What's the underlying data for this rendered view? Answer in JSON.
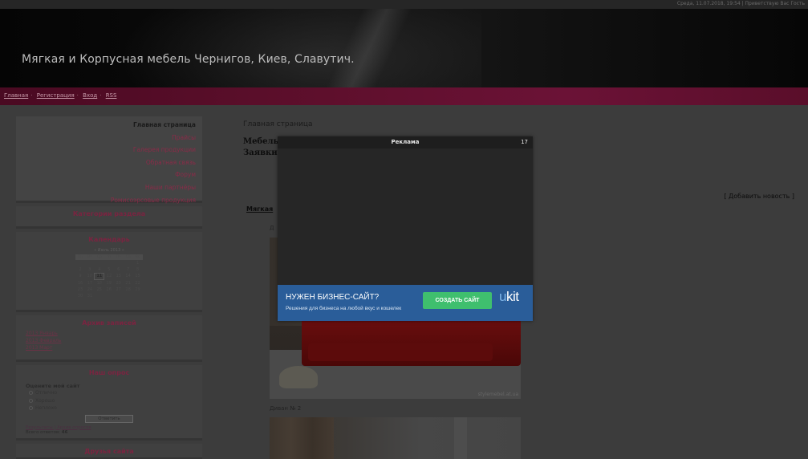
{
  "topbar": {
    "info": "Среда, 11.07.2018, 19:54 | Приветствую Вас Гость"
  },
  "header": {
    "title": "Мягкая и Корпусная мебель Чернигов, Киев, Славутич."
  },
  "nav": {
    "links": [
      "Главная",
      "Регистрация",
      "Вход",
      "RSS"
    ]
  },
  "sidebar": {
    "menu": [
      "Главная страница",
      "Прайсы",
      "Галерея продукции",
      "Обратная связь",
      "Форум",
      "Наши партнёры",
      "Ромисоэрсовые продукция"
    ],
    "categories_title": "Категории раздела",
    "calendar_title": "Календарь",
    "calendar": {
      "month": "« Июль 2013 »",
      "days": [
        "Пн",
        "Вт",
        "Ср",
        "Чт",
        "Пт",
        "Сб",
        "Вс"
      ],
      "weeks": [
        [
          "",
          "",
          "",
          "",
          "",
          "",
          "1"
        ],
        [
          "2",
          "3",
          "4",
          "5",
          "6",
          "7",
          "8"
        ],
        [
          "9",
          "10",
          "11",
          "12",
          "13",
          "14",
          "15"
        ],
        [
          "16",
          "17",
          "18",
          "19",
          "20",
          "21",
          "22"
        ],
        [
          "23",
          "24",
          "25",
          "26",
          "27",
          "28",
          "29"
        ],
        [
          "30",
          "31",
          "",
          "",
          "",
          "",
          ""
        ]
      ],
      "today": "11"
    },
    "archive_title": "Архив записей",
    "archive": [
      "2013 Январь",
      "2013 Февраль",
      "2013 Март"
    ],
    "poll_title": "Наш опрос",
    "poll": {
      "question": "Оцените мой сайт",
      "options": [
        "Отлично",
        "Хорошо",
        "Неплохо"
      ],
      "button": "Ответить",
      "links": "Результаты | Архив опросов",
      "total_label": "Всего ответов:",
      "total": "46"
    },
    "friends_title": "Друзья сайта"
  },
  "main": {
    "heading": "Главная страница",
    "intro1": "Мебель",
    "intro2": "Заявки",
    "add_news": "[ Добавить новость ]",
    "news_title": "Мягкая",
    "item1_label": "Д",
    "item2_label": "Диван № 2",
    "watermark": "stylemebel.at.ua"
  },
  "ad": {
    "label": "Реклама",
    "counter": "17",
    "headline": "НУЖЕН БИЗНЕС-САЙТ?",
    "subtext": "Решения для бизнеса на любой вкус и кошелек",
    "button": "СОЗДАТЬ САЙТ",
    "logo_u": "u",
    "logo_kit": "kit",
    "colors": {
      "banner": "#2a5d99",
      "button": "#3fbf6e"
    }
  }
}
